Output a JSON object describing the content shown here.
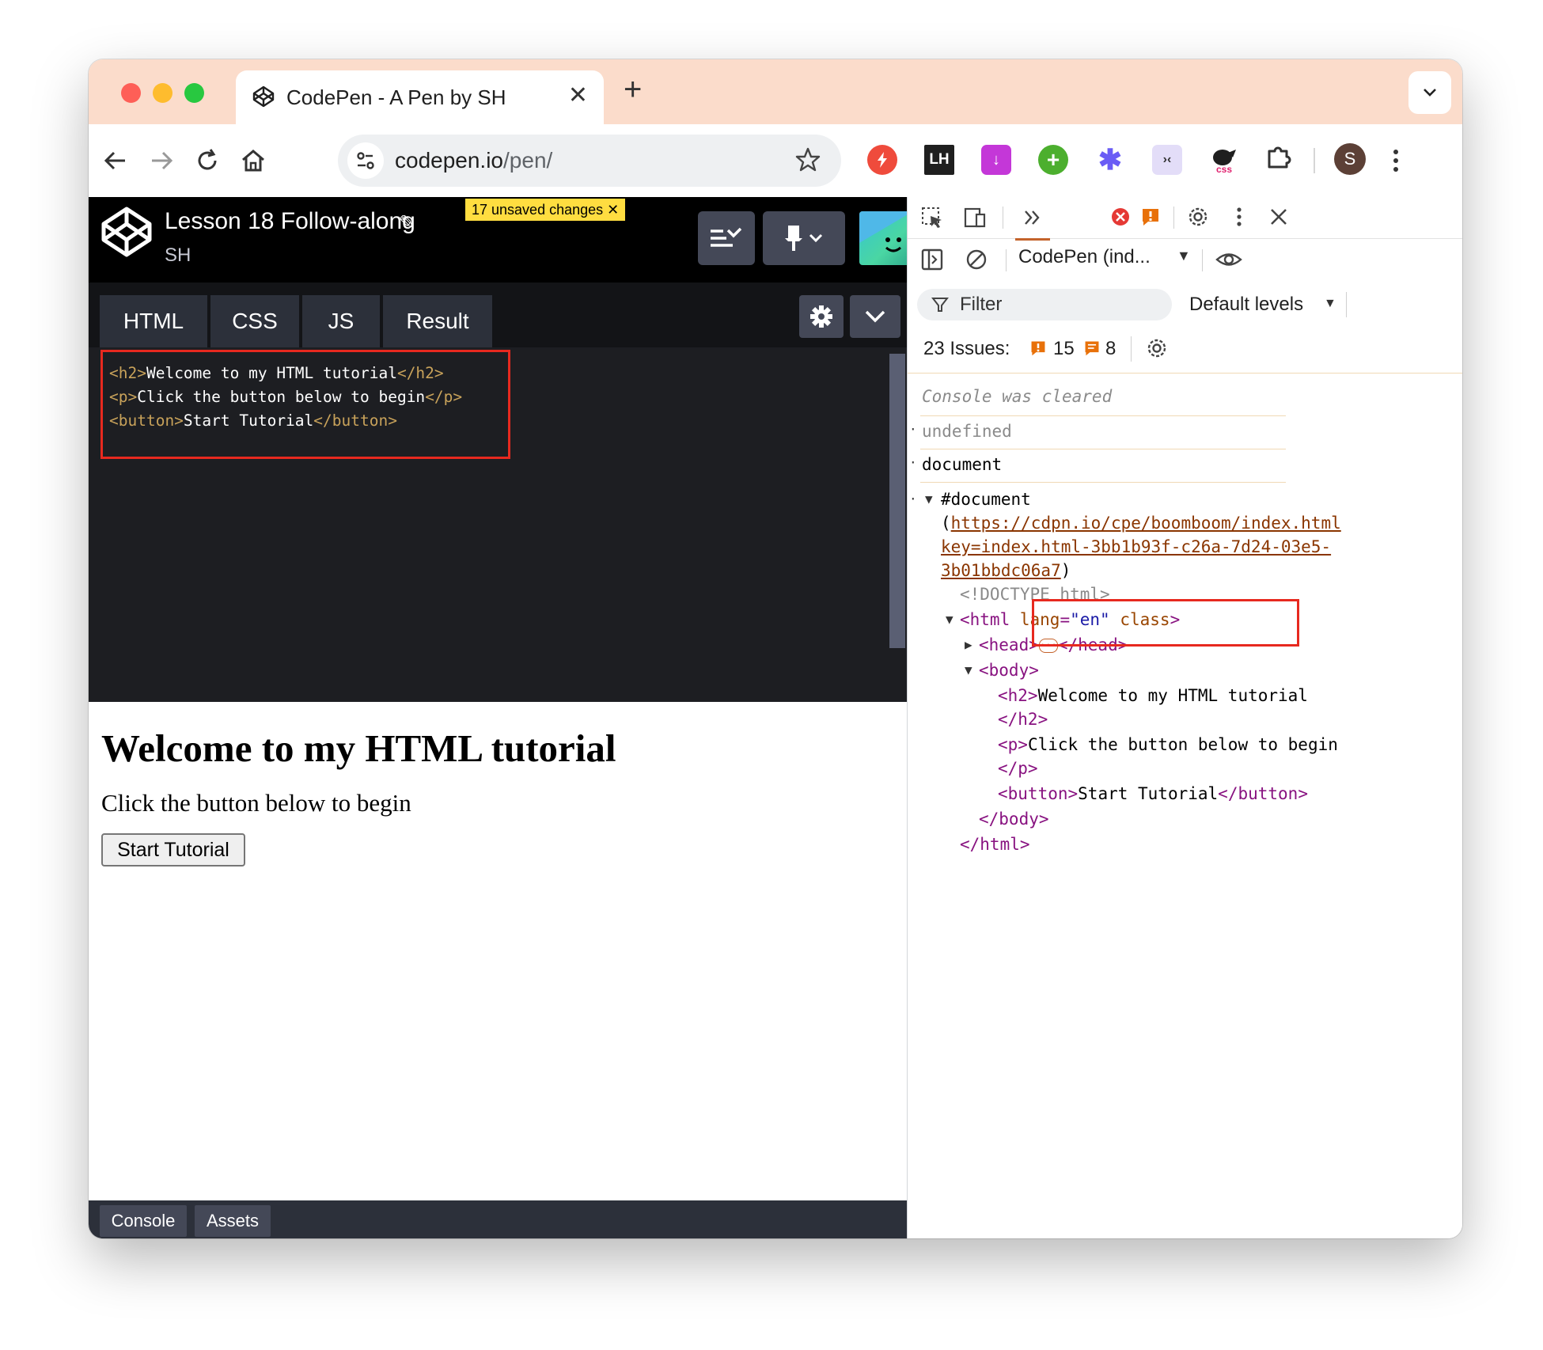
{
  "browser": {
    "tab_title": "CodePen - A Pen by SH",
    "tab_close": "✕",
    "new_tab": "+",
    "url_host": "codepen.io",
    "url_path": "/pen/",
    "profile_initial": "S",
    "extensions": [
      {
        "name": "redirect-extension",
        "label": "",
        "color": "#ef4b3c"
      },
      {
        "name": "lighthouse-extension",
        "label": "LH",
        "color": "#1f1f1f"
      },
      {
        "name": "download-extension",
        "label": "↓",
        "color": "#c437d8"
      },
      {
        "name": "plus-extension",
        "label": "+",
        "color": "#4caf2e"
      },
      {
        "name": "asterisk-extension",
        "label": "✱",
        "color": "#6a5cf5"
      },
      {
        "name": "face-extension",
        "label": "›‹",
        "color": "#d9d4f2"
      },
      {
        "name": "css-extension",
        "label": "css",
        "color": "#222222"
      }
    ]
  },
  "codepen": {
    "pen_title": "Lesson 18 Follow-along",
    "unsaved_badge": "17 unsaved changes",
    "author": "SH",
    "editor_tabs": [
      "HTML",
      "CSS",
      "JS",
      "Result"
    ],
    "code_lines": [
      {
        "open": "<h2>",
        "text": "Welcome to my HTML tutorial",
        "close": "</h2>"
      },
      {
        "open": "<p>",
        "text": "Click the button below to begin",
        "close": "</p>"
      },
      {
        "open": "<button>",
        "text": "Start Tutorial",
        "close": "</button>"
      }
    ],
    "preview": {
      "heading": "Welcome to my HTML tutorial",
      "paragraph": "Click the button below to begin",
      "button": "Start Tutorial"
    },
    "footer_buttons": [
      "Console",
      "Assets"
    ]
  },
  "devtools": {
    "context": "CodePen (ind...",
    "filter_placeholder": "Filter",
    "levels": "Default levels",
    "issues_label": "23 Issues:",
    "issues_warnings": "15",
    "issues_info": "8",
    "console": {
      "cleared": "Console was cleared",
      "undefined": "undefined",
      "document_cmd": "document",
      "document_node": "#document",
      "doc_paren_open": "(",
      "doc_url_1": "https://cdpn.io/cpe/boomboom/index.html",
      "doc_url_2": "key=index.html-3bb1b93f-c26a-7d24-03e5-",
      "doc_url_3": "3b01bbdc06a7",
      "doc_paren_close": ")",
      "doctype": "<!DOCTYPE html>",
      "html_open_tag": "<html",
      "html_lang_attr": "lang",
      "html_lang_val": "\"en\"",
      "html_class_attr": "class",
      "html_open_end": ">",
      "head_open": "<head>",
      "head_close": "</head>",
      "body_open": "<body>",
      "h2_open": "<h2>",
      "h2_text": "Welcome to my HTML tutorial",
      "h2_close": "</h2>",
      "p_open": "<p>",
      "p_text": "Click the button below to begin",
      "p_close": "</p>",
      "button_open": "<button>",
      "button_text": "Start Tutorial",
      "button_close": "</button>",
      "body_close": "</body>",
      "html_close": "</html>"
    }
  }
}
